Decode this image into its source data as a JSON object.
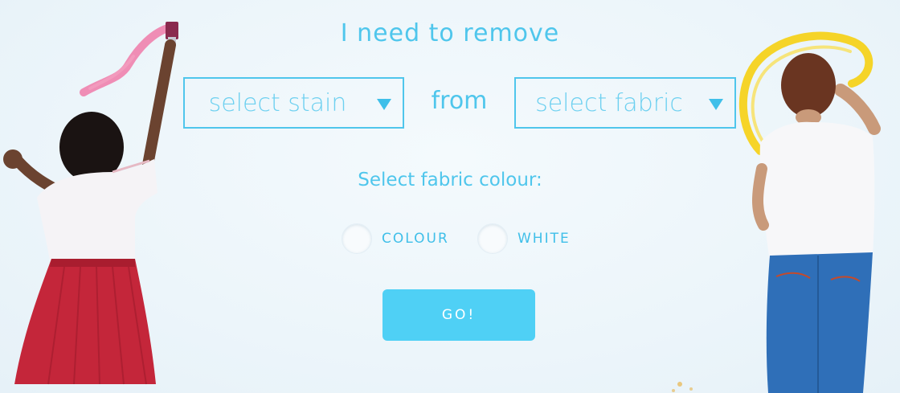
{
  "form": {
    "heading": "I need to remove",
    "stain_select": {
      "label": "select stain"
    },
    "connector": "from",
    "fabric_select": {
      "label": "select fabric"
    },
    "colour_prompt": "Select fabric colour:",
    "options": [
      {
        "label": "COLOUR",
        "selected": false
      },
      {
        "label": "WHITE",
        "selected": false
      }
    ],
    "submit_label": "GO!"
  },
  "colors": {
    "accent": "#4fc6ec",
    "button": "#4fd0f5",
    "background": "#eef6fb",
    "paint_pink": "#f07aa8",
    "paint_yellow": "#f6d21c"
  },
  "icons": {
    "dropdown": "caret-down-icon"
  }
}
